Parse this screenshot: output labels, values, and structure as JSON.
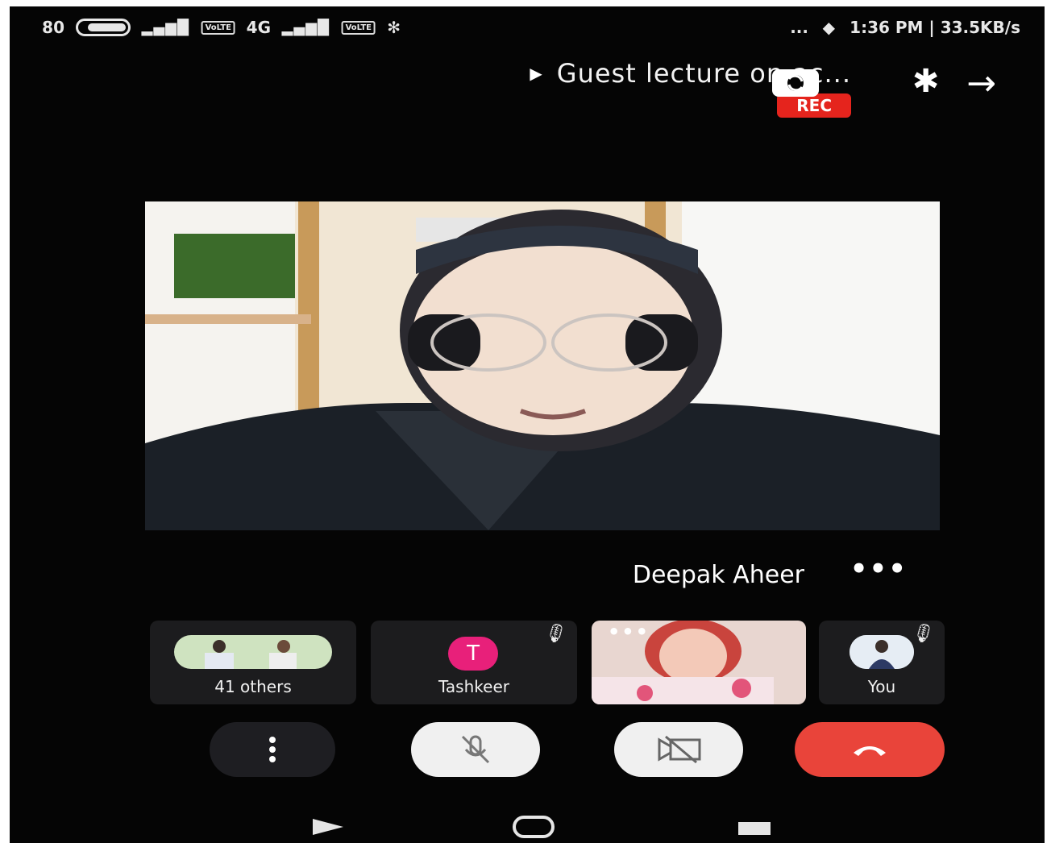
{
  "status_bar": {
    "time": "1:36 PM",
    "speed": "33.5KB/s",
    "battery": "80",
    "dots": "...",
    "volte": "VoLTE",
    "network": "4G"
  },
  "header": {
    "meeting_title": "Guest lecture on ac...",
    "rec_label": "REC"
  },
  "active_speaker": {
    "name": "Deepak Aheer"
  },
  "participants": [
    {
      "label": "You"
    },
    {
      "label": ""
    },
    {
      "label": "Tashkeer",
      "initial": "T"
    },
    {
      "label": "41 others"
    }
  ],
  "colors": {
    "rec": "#e5241d",
    "end_call": "#e9443a",
    "avatar_t": "#e8207a",
    "background": "#050505"
  },
  "icons": [
    "back-arrow-icon",
    "switch-camera-icon",
    "bluetooth-icon",
    "mic-off-icon",
    "camera-off-icon",
    "end-call-icon",
    "more-vert-icon"
  ]
}
